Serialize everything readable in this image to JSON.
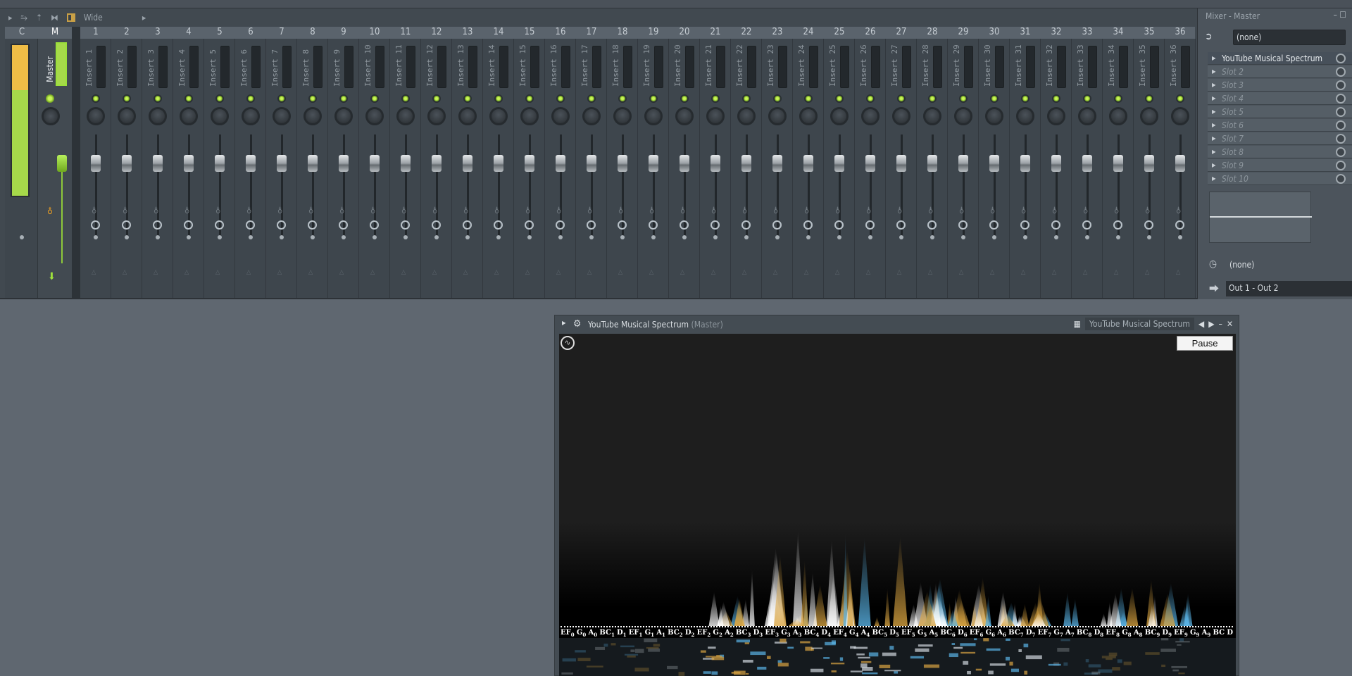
{
  "mixer": {
    "toolbar": {
      "mode_label": "Wide"
    },
    "header": {
      "c": "C",
      "m": "M"
    },
    "master_label": "Master",
    "inserts": [
      "Insert 1",
      "Insert 2",
      "Insert 3",
      "Insert 4",
      "Insert 5",
      "Insert 6",
      "Insert 7",
      "Insert 8",
      "Insert 9",
      "Insert 10",
      "Insert 11",
      "Insert 12",
      "Insert 13",
      "Insert 14",
      "Insert 15",
      "Insert 16",
      "Insert 17",
      "Insert 18",
      "Insert 19",
      "Insert 20",
      "Insert 21",
      "Insert 22",
      "Insert 23",
      "Insert 24",
      "Insert 25",
      "Insert 26",
      "Insert 27",
      "Insert 28",
      "Insert 29",
      "Insert 30",
      "Insert 31",
      "Insert 32",
      "Insert 33",
      "Insert 34",
      "Insert 35",
      "Insert 36"
    ],
    "accent": "#a6d94a"
  },
  "panel": {
    "title": "Mixer - Master",
    "eq_preset": "(none)",
    "slots": [
      "YouTube Musical Spectrum",
      "Slot 2",
      "Slot 3",
      "Slot 4",
      "Slot 5",
      "Slot 6",
      "Slot 7",
      "Slot 8",
      "Slot 9",
      "Slot 10"
    ],
    "sidechain": "(none)",
    "output": "Out 1 - Out 2"
  },
  "plugin": {
    "title": "YouTube Musical Spectrum",
    "subtitle": "(Master)",
    "preset_name": "YouTube Musical Spectrum",
    "pause_label": "Pause",
    "notes": [
      [
        "EF",
        "0"
      ],
      [
        "G",
        "0"
      ],
      [
        "A",
        "0"
      ],
      [
        "BC",
        "1"
      ],
      [
        "D",
        "1"
      ],
      [
        "EF",
        "1"
      ],
      [
        "G",
        "1"
      ],
      [
        "A",
        "1"
      ],
      [
        "BC",
        "2"
      ],
      [
        "D",
        "2"
      ],
      [
        "EF",
        "2"
      ],
      [
        "G",
        "2"
      ],
      [
        "A",
        "2"
      ],
      [
        "BC",
        "3"
      ],
      [
        "D",
        "3"
      ],
      [
        "EF",
        "3"
      ],
      [
        "G",
        "3"
      ],
      [
        "A",
        "3"
      ],
      [
        "BC",
        "4"
      ],
      [
        "D",
        "4"
      ],
      [
        "EF",
        "4"
      ],
      [
        "G",
        "4"
      ],
      [
        "A",
        "4"
      ],
      [
        "BC",
        "5"
      ],
      [
        "D",
        "5"
      ],
      [
        "EF",
        "5"
      ],
      [
        "G",
        "5"
      ],
      [
        "A",
        "5"
      ],
      [
        "BC",
        "6"
      ],
      [
        "D",
        "6"
      ],
      [
        "EF",
        "6"
      ],
      [
        "G",
        "6"
      ],
      [
        "A",
        "6"
      ],
      [
        "BC",
        "7"
      ],
      [
        "D",
        "7"
      ],
      [
        "EF",
        "7"
      ],
      [
        "G",
        "7"
      ],
      [
        "A",
        "7"
      ],
      [
        "BC",
        "8"
      ],
      [
        "D",
        "8"
      ],
      [
        "EF",
        "8"
      ],
      [
        "G",
        "8"
      ],
      [
        "A",
        "8"
      ],
      [
        "BC",
        "9"
      ],
      [
        "D",
        "9"
      ],
      [
        "EF",
        "9"
      ],
      [
        "G",
        "9"
      ],
      [
        "A",
        "9"
      ],
      [
        "BC",
        ""
      ],
      [
        "D",
        ""
      ]
    ]
  }
}
